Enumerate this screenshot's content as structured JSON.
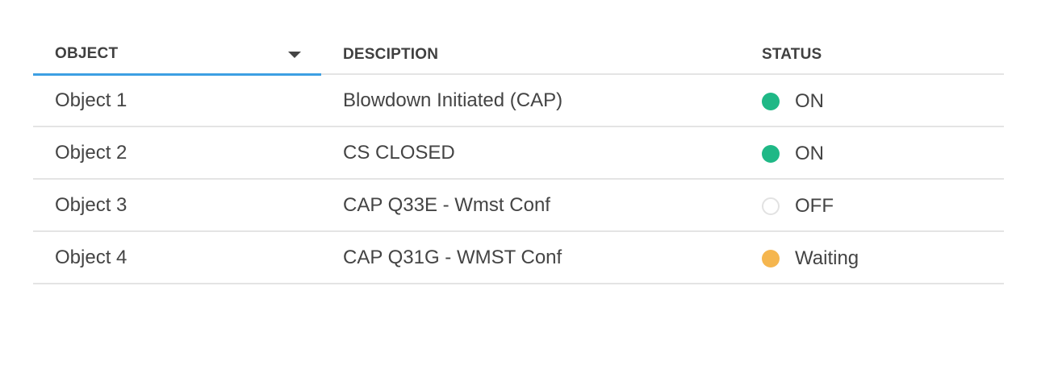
{
  "table": {
    "headers": {
      "object": "OBJECT",
      "description": "DESCIPTION",
      "status": "STATUS"
    },
    "sort": {
      "column": "object",
      "direction": "descending",
      "active_color": "#3d9fe3"
    },
    "status_colors": {
      "ON": "#1fb886",
      "OFF": "#ffffff",
      "Waiting": "#f5b64f"
    },
    "rows": [
      {
        "object": "Object 1",
        "description": "Blowdown Initiated (CAP)",
        "status": "ON"
      },
      {
        "object": "Object 2",
        "description": "CS CLOSED",
        "status": "ON"
      },
      {
        "object": "Object 3",
        "description": "CAP Q33E - Wmst Conf",
        "status": "OFF"
      },
      {
        "object": "Object 4",
        "description": "CAP Q31G - WMST Conf",
        "status": "Waiting"
      }
    ]
  }
}
